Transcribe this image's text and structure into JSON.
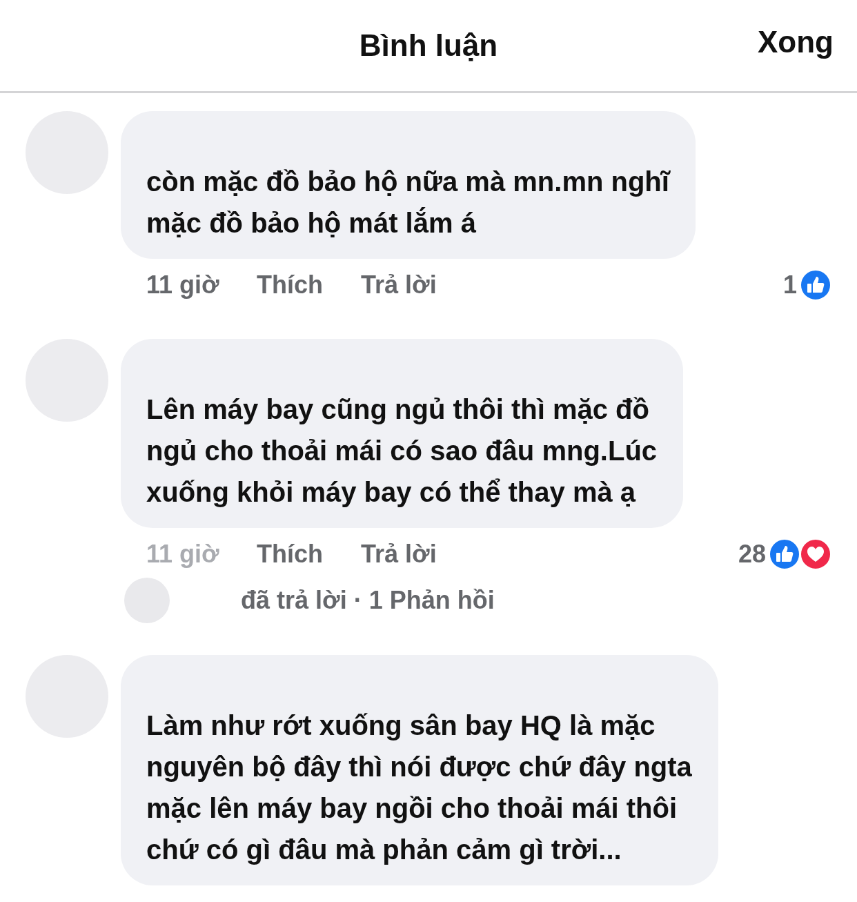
{
  "header": {
    "title": "Bình luận",
    "done": "Xong"
  },
  "comments": [
    {
      "text": " còn mặc đồ bảo hộ nữa mà mn.mn nghĩ\nmặc đồ bảo hộ mát lắm á",
      "time": "11 giờ",
      "time_faded": false,
      "like": "Thích",
      "reply": "Trả lời",
      "reaction_count": "1",
      "reactions": [
        {
          "kind": "like"
        }
      ]
    },
    {
      "text": "Lên máy bay cũng ngủ thôi thì mặc đồ\nngủ cho thoải mái có sao đâu mng.Lúc\nxuống khỏi máy bay có thể thay mà ạ",
      "time": "11 giờ",
      "time_faded": true,
      "like": "Thích",
      "reply": "Trả lời",
      "reaction_count": "28",
      "reactions": [
        {
          "kind": "like"
        },
        {
          "kind": "love"
        }
      ],
      "replies": "đã **trả lời** · 1 Phản hồi"
    },
    {
      "text": "Làm như rớt xuống sân bay HQ là mặc\nnguyên bộ đây thì nói được chứ đây ngta\nmặc lên máy bay ngồi cho thoải mái thôi\nchứ có gì đâu mà phản cảm gì trời..."
    }
  ]
}
